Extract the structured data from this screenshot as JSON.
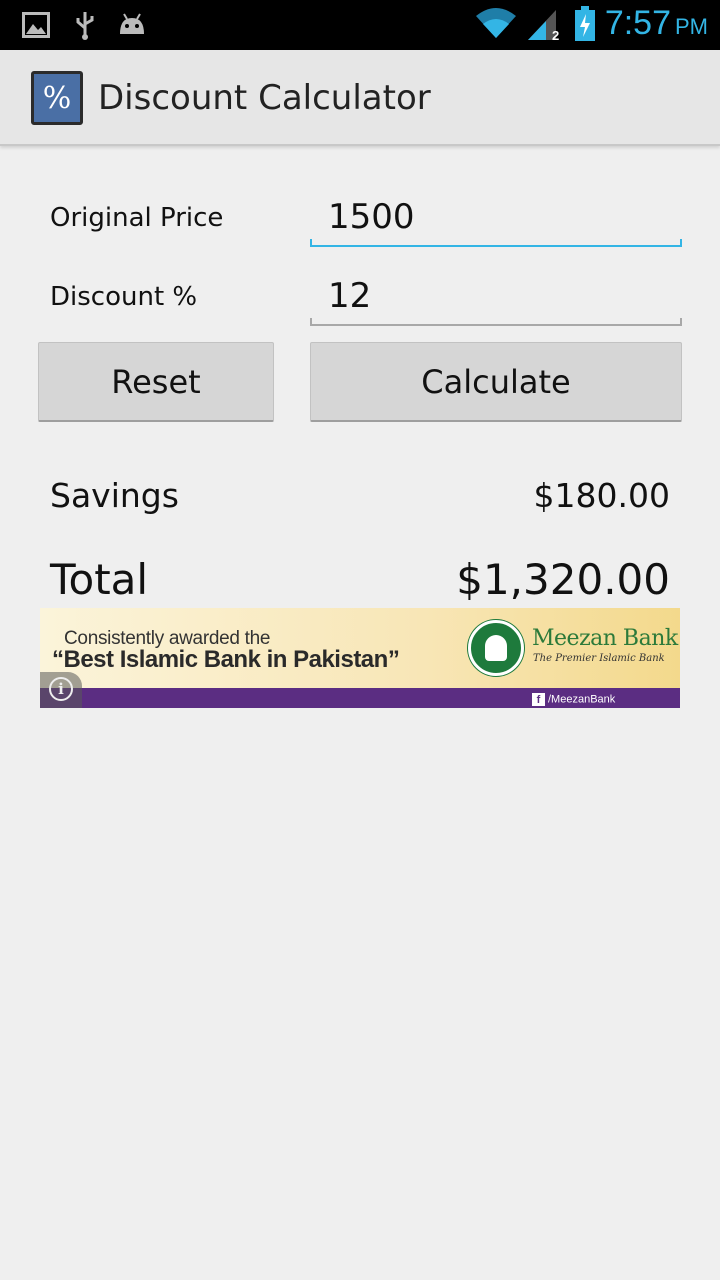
{
  "status_bar": {
    "time": "7:57",
    "ampm": "PM",
    "icons": [
      "image-icon",
      "usb-icon",
      "android-debug-icon",
      "wifi-icon",
      "signal-icon",
      "battery-charging-icon"
    ],
    "accent_color": "#33b5e5"
  },
  "action_bar": {
    "app_icon_glyph": "%",
    "title": "Discount Calculator"
  },
  "form": {
    "original_price_label": "Original Price",
    "original_price_value": "1500",
    "discount_label": "Discount %",
    "discount_value": "12",
    "focus_color": "#33b5e5"
  },
  "buttons": {
    "reset_label": "Reset",
    "calculate_label": "Calculate"
  },
  "results": {
    "savings_label": "Savings",
    "savings_value": "$180.00",
    "total_label": "Total",
    "total_value": "$1,320.00"
  },
  "ad": {
    "line1": "Consistently awarded the",
    "line2": "“Best Islamic Bank in Pakistan”",
    "brand": "Meezan Bank",
    "tagline": "The Premier Islamic Bank",
    "facebook": "/MeezanBank",
    "info_glyph": "i"
  }
}
